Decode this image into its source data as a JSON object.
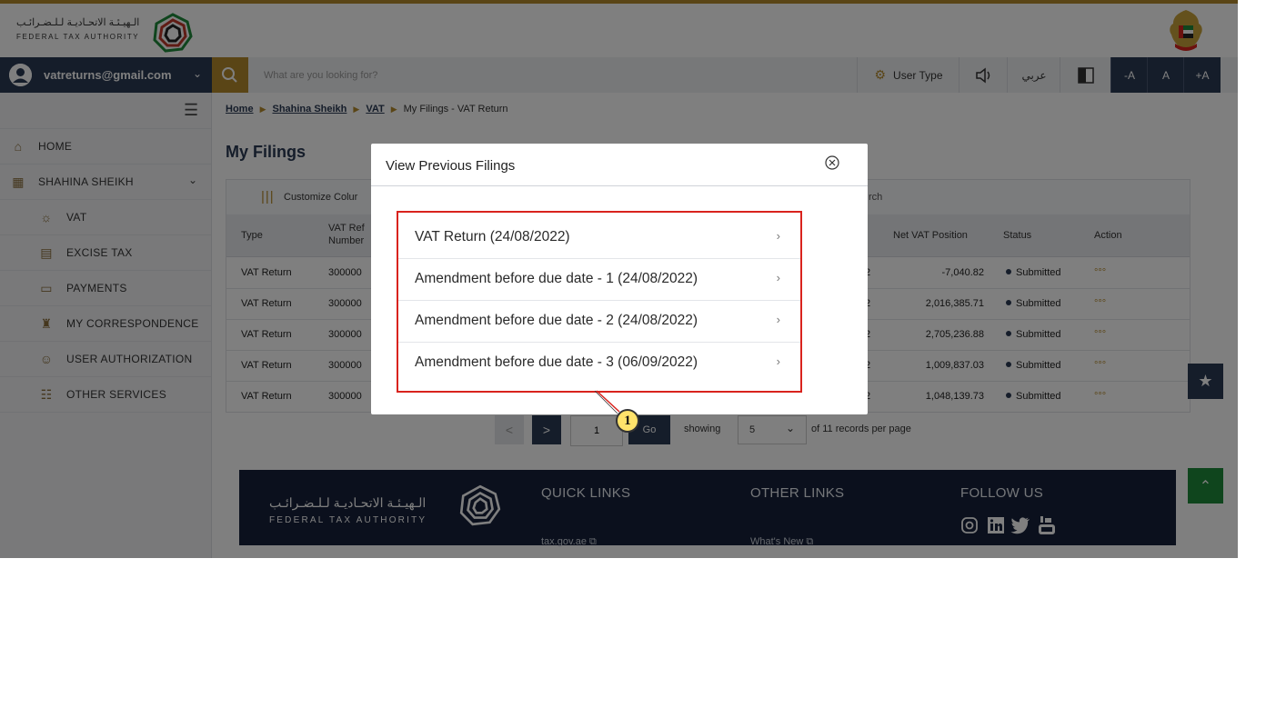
{
  "header": {
    "logo_ar": "الـهيـئـة الاتحـاديـة لـلـضـرائـب",
    "logo_en": "FEDERAL TAX AUTHORITY"
  },
  "navbar": {
    "user_email": "vatreturns@gmail.com",
    "search_placeholder": "What are you looking for?",
    "user_type_label": "User Type",
    "arabic_label": "عربي",
    "font_decrease": "-A",
    "font_normal": "A",
    "font_increase": "+A"
  },
  "sidebar": {
    "items": [
      {
        "label": "HOME",
        "icon": "home-icon"
      },
      {
        "label": "SHAHINA SHEIKH",
        "icon": "grid-icon"
      },
      {
        "label": "VAT",
        "icon": "vat-icon"
      },
      {
        "label": "EXCISE TAX",
        "icon": "excise-icon"
      },
      {
        "label": "PAYMENTS",
        "icon": "payments-icon"
      },
      {
        "label": "MY CORRESPONDENCE",
        "icon": "correspondence-icon"
      },
      {
        "label": "USER AUTHORIZATION",
        "icon": "user-auth-icon"
      },
      {
        "label": "OTHER SERVICES",
        "icon": "services-icon"
      }
    ]
  },
  "breadcrumb": {
    "home": "Home",
    "user": "Shahina Sheikh",
    "vat": "VAT",
    "current": "My Filings - VAT Return"
  },
  "page": {
    "title": "My Filings",
    "customize": "Customize Colur",
    "search_partial": "rch"
  },
  "table": {
    "headers": {
      "type": "Type",
      "vat_ref": "VAT Ref",
      "vat_ref2": "Number",
      "net": "Net VAT Position",
      "status": "Status",
      "action": "Action"
    },
    "rows": [
      {
        "type": "VAT Return",
        "ref": "300000",
        "net": "-7,040.82",
        "status": "Submitted",
        "action": "°°°",
        "edge": "2"
      },
      {
        "type": "VAT Return",
        "ref": "300000",
        "net": "2,016,385.71",
        "status": "Submitted",
        "action": "°°°",
        "edge": "2"
      },
      {
        "type": "VAT Return",
        "ref": "300000",
        "net": "2,705,236.88",
        "status": "Submitted",
        "action": "°°°",
        "edge": "2"
      },
      {
        "type": "VAT Return",
        "ref": "300000",
        "net": "1,009,837.03",
        "status": "Submitted",
        "action": "°°°",
        "edge": "2"
      },
      {
        "type": "VAT Return",
        "ref": "300000",
        "net": "1,048,139.73",
        "status": "Submitted",
        "action": "°°°",
        "edge": "2"
      }
    ]
  },
  "pagination": {
    "prev": "<",
    "next": ">",
    "page": "1",
    "go": "Go",
    "showing": "showing",
    "per_page": "5",
    "suffix": "of 11 records per page"
  },
  "footer": {
    "logo_ar": "الـهيـئـة الاتحـاديـة لـلـضـرائـب",
    "logo_en": "FEDERAL TAX AUTHORITY",
    "quick_links": "QUICK LINKS",
    "quick_link_1": "tax.gov.ae",
    "other_links": "OTHER LINKS",
    "other_link_1": "What's New",
    "follow_us": "FOLLOW US"
  },
  "modal": {
    "title": "View Previous Filings",
    "items": [
      "VAT Return (24/08/2022)",
      "Amendment before due date - 1 (24/08/2022)",
      "Amendment before due date - 2 (24/08/2022)",
      "Amendment before due date - 3 (06/09/2022)"
    ]
  },
  "callout": {
    "number": "1"
  },
  "colors": {
    "navy": "#2b3a55",
    "gold": "#b58a2c",
    "highlight_red": "#d9231d",
    "footer": "#16213a",
    "green": "#1f8a3b"
  }
}
